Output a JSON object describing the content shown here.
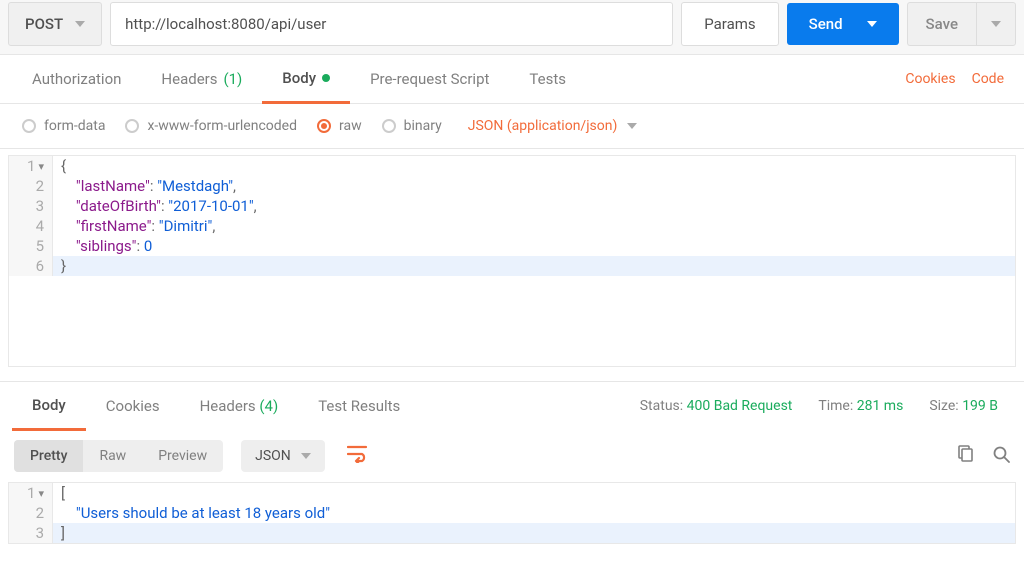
{
  "topbar": {
    "method": "POST",
    "url": "http://localhost:8080/api/user",
    "params": "Params",
    "send": "Send",
    "save": "Save"
  },
  "requestTabs": {
    "authorization": "Authorization",
    "headers": "Headers",
    "headersCount": "(1)",
    "body": "Body",
    "prerequest": "Pre-request Script",
    "tests": "Tests",
    "cookies": "Cookies",
    "code": "Code"
  },
  "bodyTypes": {
    "formData": "form-data",
    "urlencoded": "x-www-form-urlencoded",
    "raw": "raw",
    "binary": "binary",
    "contentType": "JSON (application/json)"
  },
  "requestBody": {
    "lines": [
      {
        "n": "1",
        "fold": true,
        "html": "<span class='tok-punc'>{</span>"
      },
      {
        "n": "2",
        "html": "    <span class='tok-key'>\"lastName\"</span><span class='tok-punc'>: </span><span class='tok-str'>\"Mestdagh\"</span><span class='tok-punc'>,</span>"
      },
      {
        "n": "3",
        "html": "    <span class='tok-key'>\"dateOfBirth\"</span><span class='tok-punc'>: </span><span class='tok-str'>\"2017-10-01\"</span><span class='tok-punc'>,</span>"
      },
      {
        "n": "4",
        "html": "    <span class='tok-key'>\"firstName\"</span><span class='tok-punc'>: </span><span class='tok-str'>\"Dimitri\"</span><span class='tok-punc'>,</span>"
      },
      {
        "n": "5",
        "html": "    <span class='tok-key'>\"siblings\"</span><span class='tok-punc'>: </span><span class='tok-num'>0</span>"
      },
      {
        "n": "6",
        "hl": true,
        "html": "<span class='tok-punc'>}</span>"
      }
    ]
  },
  "responseTabs": {
    "body": "Body",
    "cookies": "Cookies",
    "headers": "Headers",
    "headersCount": "(4)",
    "testResults": "Test Results"
  },
  "responseMeta": {
    "statusLabel": "Status:",
    "statusValue": "400 Bad Request",
    "timeLabel": "Time:",
    "timeValue": "281 ms",
    "sizeLabel": "Size:",
    "sizeValue": "199 B"
  },
  "formatBar": {
    "pretty": "Pretty",
    "raw": "Raw",
    "preview": "Preview",
    "json": "JSON"
  },
  "responseBody": {
    "lines": [
      {
        "n": "1",
        "fold": true,
        "html": "<span class='tok-punc'>[</span>"
      },
      {
        "n": "2",
        "html": "    <span class='tok-str'>\"Users should be at least 18 years old\"</span>"
      },
      {
        "n": "3",
        "hl": true,
        "html": "<span class='tok-punc'>]</span>"
      }
    ]
  }
}
